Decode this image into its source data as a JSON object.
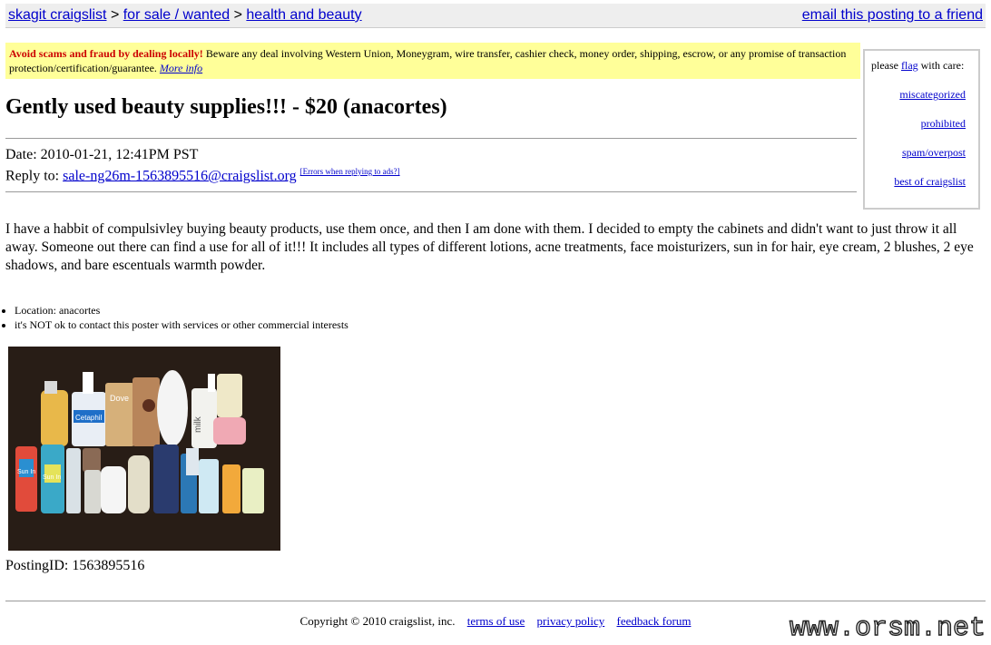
{
  "breadcrumb": {
    "site": "skagit craigslist",
    "sep1": ">",
    "category": "for sale / wanted",
    "sep2": ">",
    "subcategory": "health and beauty"
  },
  "email_link": "email this posting to a friend",
  "scam_notice": {
    "warning": "Avoid scams and fraud by dealing locally!",
    "text": " Beware any deal involving Western Union, Moneygram, wire transfer, cashier check, money order, shipping, escrow, or any promise of transaction protection/certification/guarantee. ",
    "more": "More info"
  },
  "flag_box": {
    "prefix": "please ",
    "flag": "flag",
    "suffix": " with care:",
    "links": [
      "miscategorized",
      "prohibited",
      "spam/overpost",
      "best of craigslist"
    ]
  },
  "posting": {
    "title": "Gently used beauty supplies!!! - $20 (anacortes)",
    "date_label": "Date: 2010-01-21, 12:41PM PST",
    "reply_label": "Reply to: ",
    "reply_email": "sale-ng26m-1563895516@craigslist.org",
    "errors_link": "[Errors when replying to ads?]",
    "body": "I have a habbit of compulsivley buying beauty products, use them once, and then I am done with them. I decided to empty the cabinets and didn't want to just throw it all away. Someone out there can find a use for all of it!!! It includes all types of different lotions, acne treatments, face moisturizers, sun in for hair, eye cream, 2 blushes, 2 eye shadows, and bare escentuals warmth powder.",
    "bullets": [
      "Location: anacortes",
      "it's NOT ok to contact this poster with services or other commercial interests"
    ],
    "photo_labels": [
      "Cetaphil",
      "Dove",
      "milk",
      "Sun In",
      "Sun In"
    ],
    "posting_id": "PostingID: 1563895516"
  },
  "footer": {
    "copyright": "Copyright © 2010 craigslist, inc.",
    "links": [
      "terms of use",
      "privacy policy",
      "feedback forum"
    ]
  },
  "watermark": "www.orsm.net",
  "colors": {
    "link": "#0000cc",
    "scam_bg": "#ffff99",
    "warning": "#cc0000",
    "topbar_bg": "#eeeeee"
  }
}
